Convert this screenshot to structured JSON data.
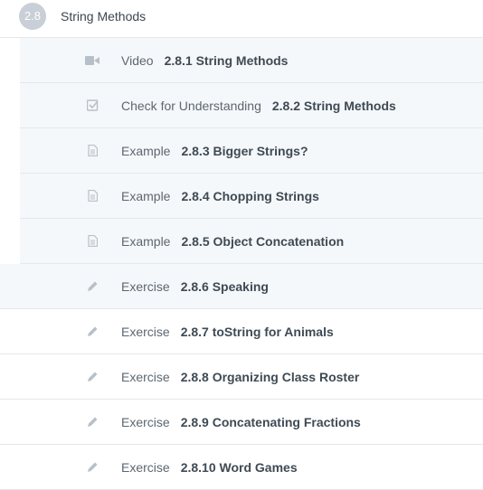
{
  "section": {
    "number": "2.8",
    "title": "String Methods"
  },
  "items": [
    {
      "type": "Video",
      "title": "2.8.1 String Methods",
      "icon": "video-camera-icon",
      "style": "done"
    },
    {
      "type": "Check for Understanding",
      "title": "2.8.2 String Methods",
      "icon": "checkbox-icon",
      "style": "done"
    },
    {
      "type": "Example",
      "title": "2.8.3 Bigger Strings?",
      "icon": "document-icon",
      "style": "done"
    },
    {
      "type": "Example",
      "title": "2.8.4 Chopping Strings",
      "icon": "document-icon",
      "style": "done"
    },
    {
      "type": "Example",
      "title": "2.8.5 Object Concatenation",
      "icon": "document-icon",
      "style": "done"
    },
    {
      "type": "Exercise",
      "title": "2.8.6 Speaking",
      "icon": "pencil-icon",
      "style": "full"
    },
    {
      "type": "Exercise",
      "title": "2.8.7 toString for Animals",
      "icon": "pencil-icon",
      "style": "plain"
    },
    {
      "type": "Exercise",
      "title": "2.8.8 Organizing Class Roster",
      "icon": "pencil-icon",
      "style": "plain"
    },
    {
      "type": "Exercise",
      "title": "2.8.9 Concatenating Fractions",
      "icon": "pencil-icon",
      "style": "plain"
    },
    {
      "type": "Exercise",
      "title": "2.8.10 Word Games",
      "icon": "pencil-icon",
      "style": "plain"
    }
  ],
  "colors": {
    "icon": "#b7c0c8",
    "badge": "#c8cfd7",
    "row_done": "#f5f8fa",
    "border": "#e3e8ee"
  }
}
